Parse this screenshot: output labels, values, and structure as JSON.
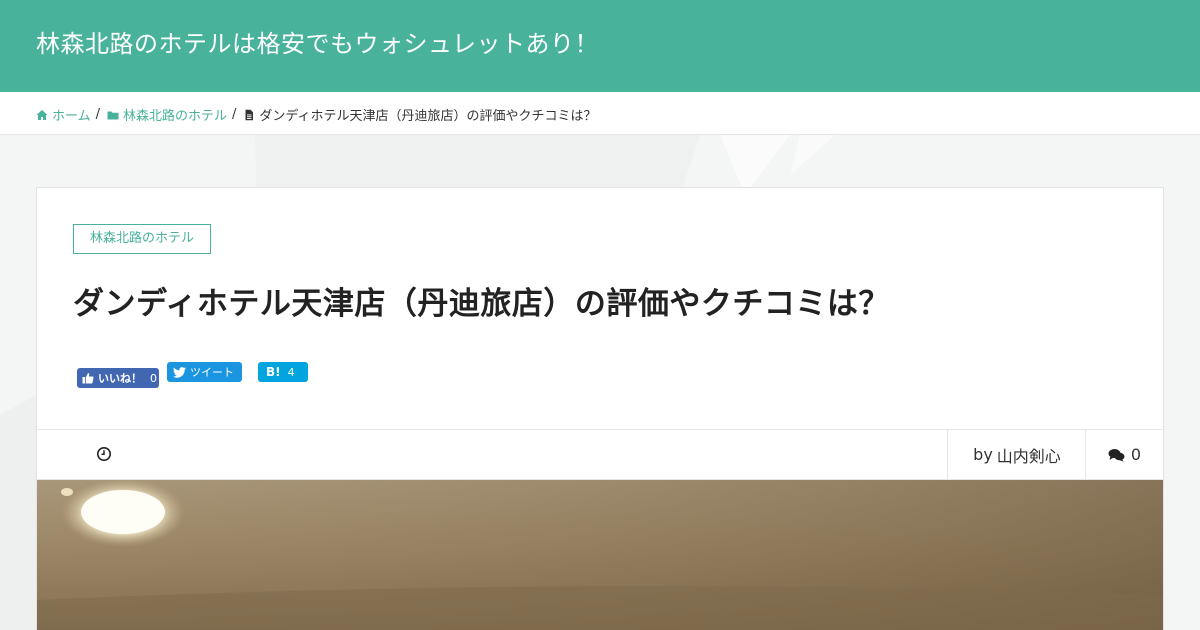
{
  "site": {
    "title": "林森北路のホテルは格安でもウォシュレットあり！"
  },
  "breadcrumb": {
    "home_label": "ホーム",
    "category_label": "林森北路のホテル",
    "current_label": "ダンディホテル天津店（丹迪旅店）の評価やクチコミは？",
    "separator": "/"
  },
  "article": {
    "category_tag": "林森北路のホテル",
    "title": "ダンディホテル天津店（丹迪旅店）の評価やクチコミは？"
  },
  "share": {
    "like_label": "いいね！",
    "like_count": "0",
    "tweet_label": "ツイート",
    "hatena_label": "B!",
    "hatena_count": "4"
  },
  "meta": {
    "author_prefix": "by",
    "author_name": "山内剣心",
    "comment_count": "0"
  },
  "colors": {
    "accent": "#49b29b",
    "facebook": "#4267b2",
    "twitter": "#1b95e0",
    "hatena": "#00a4de"
  },
  "icons": {
    "home": "home-icon",
    "folder": "folder-icon",
    "file": "file-icon",
    "clock": "clock-icon",
    "comments": "comments-icon"
  }
}
